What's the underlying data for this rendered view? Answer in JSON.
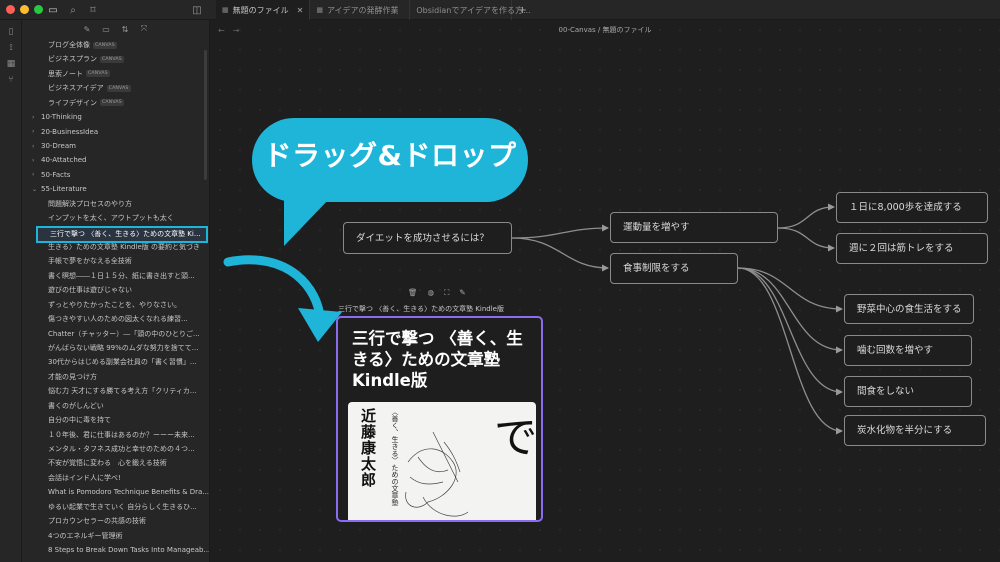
{
  "window": {
    "traffic_lights": [
      "#ff5f57",
      "#febc2e",
      "#28c840"
    ]
  },
  "tabs": [
    {
      "label": "無題のファイル",
      "active": true
    },
    {
      "label": "アイデアの発酵作業",
      "active": false
    },
    {
      "label": "Obsidianでアイデアを作る方...",
      "active": false
    }
  ],
  "breadcrumb": "00-Canvas / 無題のファイル",
  "sidebar": {
    "canvas_tag": "CANVAS",
    "items": [
      {
        "label": "ブログ全体像",
        "canvas": true
      },
      {
        "label": "ビジネスプラン",
        "canvas": true
      },
      {
        "label": "思索ノート",
        "canvas": true
      },
      {
        "label": "ビジネスアイデア",
        "canvas": true
      },
      {
        "label": "ライフデザイン",
        "canvas": true
      },
      {
        "label": "10-Thinking",
        "folder": "closed"
      },
      {
        "label": "20-BusinessIdea",
        "folder": "closed"
      },
      {
        "label": "30-Dream",
        "folder": "closed"
      },
      {
        "label": "40-Attatched",
        "folder": "closed"
      },
      {
        "label": "50-Facts",
        "folder": "closed"
      },
      {
        "label": "55-Literature",
        "folder": "open"
      },
      {
        "label": "問題解決プロセスのやり方"
      },
      {
        "label": "インプットを太く、アウトプットも太く"
      },
      {
        "label": "三行で撃つ 〈善く、生きる〉ための文章塾 Ki...",
        "highlight": true
      },
      {
        "label": "生きる〉ための文章塾 Kindle版 の要約と気づき"
      },
      {
        "label": "手帳で夢をかなえる全技術"
      },
      {
        "label": "書く瞑想――１日１５分、紙に書き出すと頭..."
      },
      {
        "label": "遊びの仕事は遊びじゃない"
      },
      {
        "label": "ずっとやりたかったことを、やりなさい。"
      },
      {
        "label": "傷つきやすい人のための図太くなれる練習..."
      },
      {
        "label": "Chatter（チャッター）―「頭の中のひとりご..."
      },
      {
        "label": "がんばらない戦略 99%のムダな努力を捨てて..."
      },
      {
        "label": "30代からはじめる副業会社員の「書く習慣」..."
      },
      {
        "label": "才能の見つけ方"
      },
      {
        "label": "悩む力 天才にする勝てる考え方「クリティカ..."
      },
      {
        "label": "書くのがしんどい"
      },
      {
        "label": "自分の中に毒を持て"
      },
      {
        "label": "１０年後、君に仕事はあるのか？ーーー未来..."
      },
      {
        "label": "メンタル・タフネス成功と幸せのための４つ..."
      },
      {
        "label": "不安が覚悟に変わる　心を鍛える技術"
      },
      {
        "label": "会話はインド人に学べ!"
      },
      {
        "label": "What is Pomodoro Technique Benefits & Dra..."
      },
      {
        "label": "ゆるい起業で生きていく 自分らしく生きるひ..."
      },
      {
        "label": "プロカウンセラーの共感の技術"
      },
      {
        "label": "4つのエネルギー管理術"
      },
      {
        "label": "8 Steps to Break Down Tasks Into Manageab..."
      }
    ]
  },
  "callout": {
    "text": "ドラッグ&ドロップ",
    "color": "#1fb5d8"
  },
  "canvas_nodes": {
    "root": "ダイエットを成功させるには？",
    "exercise": "運動量を増やす",
    "diet": "食事制限をする",
    "steps": "１日に8,000歩を達成する",
    "training": "週に２回は筋トレをする",
    "veg": "野菜中心の食生活をする",
    "chew": "噛む回数を増やす",
    "snack": "間食をしない",
    "carbs": "炭水化物を半分にする"
  },
  "file_card": {
    "label": "三行で撃つ 〈善く、生きる〉ための文章塾 Kindle版",
    "heading": "三行で撃つ 〈善く、生きる〉ための文章塾 Kindle版",
    "book_author": "近藤康太郎",
    "book_subtitle": "〈善く、生きる〉ための文章塾",
    "book_title_glyphs": "三行で",
    "border_color": "#8b6cf0"
  }
}
